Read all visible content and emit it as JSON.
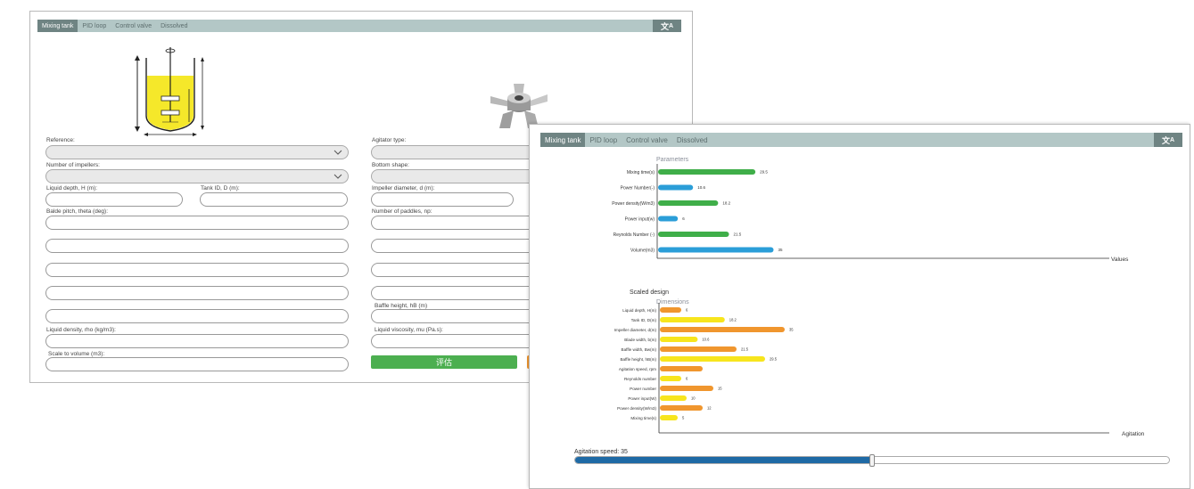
{
  "tabs": [
    "Mixing tank",
    "PID loop",
    "Control valve",
    "Dissolved"
  ],
  "translate_icon": "translate-icon",
  "form": {
    "reference_label": "Reference:",
    "impellers_label": "Number of impellers:",
    "liquid_depth_label": "Liquid depth, H (m):",
    "tank_id_label": "Tank ID, D (m):",
    "blade_pitch_label": "Balde pitch, theta (deg):",
    "liquid_density_label": "Liquid density, rho (kg/m3):",
    "scale_volume_label": "Scale to volume (m3):",
    "agitator_type_label": "Agitator type:",
    "bottom_shape_label": "Bottom shape:",
    "impeller_diameter_label": "Impeller diameter, d (m):",
    "paddles_label": "Number of paddles, np:",
    "baffle_height_label": "Baffle height, hB (m)",
    "liquid_viscosity_label": "Liquid viscosity, mu (Pa.s):",
    "evaluate_label": "评估"
  },
  "colors": {
    "green": "#3fae49",
    "blue": "#2b9ed8",
    "orange": "#f0962e",
    "yellow": "#f7e51d",
    "tab_active": "#6f8483",
    "tab_bar": "#b3c7c6",
    "slider": "#1f6aa5"
  },
  "chart_data": [
    {
      "type": "bar",
      "title": "",
      "subtitle": "Parameters",
      "xlabel": "Values",
      "categories": [
        "Mixing time(s)",
        "Power Number(-)",
        "Power density(W/m3)",
        "Power input(w)",
        "Reynolds Number (-)",
        "Volume(m3)"
      ],
      "values": [
        29.5,
        10.6,
        18.2,
        6,
        21.5,
        35
      ],
      "value_labels": [
        "29.5",
        "10.6",
        "18.2",
        "6",
        "21.5",
        "35"
      ],
      "bar_colors": [
        "#3fae49",
        "#2b9ed8",
        "#3fae49",
        "#2b9ed8",
        "#3fae49",
        "#2b9ed8"
      ],
      "xlim": [
        0,
        55
      ]
    },
    {
      "type": "bar",
      "title": "Scaled design",
      "subtitle": "Dimensions",
      "xlabel": "Agitation",
      "categories": [
        "Liquid depth, H(m)",
        "Tank ID, D(m)",
        "Impeller diameter, d(m)",
        "Blade width, b(m)",
        "Baffle width, Bw(m)",
        "Baffle height, hB(m)",
        "Agitation speed, rpm",
        "Reynolds number",
        "Power number",
        "Power input(W)",
        "Power density(W/m3)",
        "Mixing time(s)"
      ],
      "values": [
        6,
        18.2,
        35,
        10.6,
        21.5,
        29.5,
        12,
        6,
        15,
        7.5,
        12,
        5
      ],
      "value_labels": [
        "6",
        "18.2",
        "35",
        "10.6",
        "21.5",
        "29.5",
        "",
        "6",
        "15",
        "10",
        "12",
        "5"
      ],
      "bar_colors": [
        "#f0962e",
        "#f7e51d",
        "#f0962e",
        "#f7e51d",
        "#f0962e",
        "#f7e51d",
        "#f0962e",
        "#f7e51d",
        "#f0962e",
        "#f7e51d",
        "#f0962e",
        "#f7e51d"
      ],
      "xlim": [
        0,
        85
      ]
    }
  ],
  "slider": {
    "label": "Agitation speed: 35",
    "value_fraction": 0.5
  }
}
